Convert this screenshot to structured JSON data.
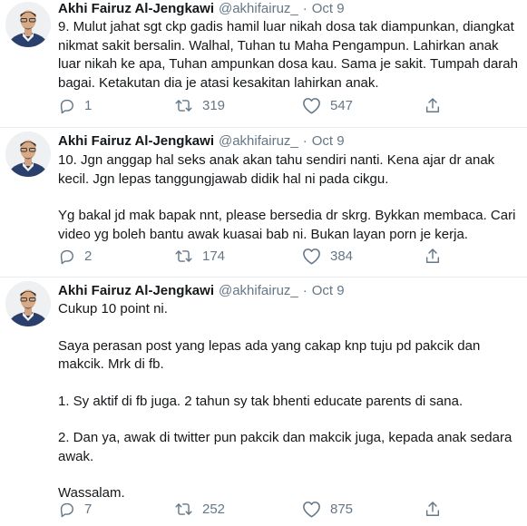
{
  "icons": {
    "reply": "reply-icon",
    "retweet": "retweet-icon",
    "like": "heart-icon",
    "share": "share-icon"
  },
  "colors": {
    "text": "#14171a",
    "secondary": "#657786",
    "divider": "#e6ecf0"
  },
  "tweets": [
    {
      "author": {
        "name": "Akhi Fairuz Al-Jengkawi",
        "handle": "@akhifairuz_"
      },
      "separator": "·",
      "date": "Oct 9",
      "paragraphs": [
        "9. Mulut jahat sgt ckp gadis hamil luar nikah dosa tak diampunkan, diangkat nikmat sakit bersalin. Walhal, Tuhan tu Maha Pengampun. Lahirkan anak luar nikah ke apa, Tuhan ampunkan dosa kau. Sama je sakit. Tumpah darah bagai. Ketakutan dia je atasi kesakitan lahirkan anak."
      ],
      "stats": {
        "replies": "1",
        "retweets": "319",
        "likes": "547"
      }
    },
    {
      "author": {
        "name": "Akhi Fairuz Al-Jengkawi",
        "handle": "@akhifairuz_"
      },
      "separator": "·",
      "date": "Oct 9",
      "paragraphs": [
        "10. Jgn anggap hal seks anak akan tahu sendiri nanti. Kena ajar dr anak kecil. Jgn lepas tanggungjawab didik hal ni pada cikgu.",
        "Yg bakal jd mak bapak nnt, please bersedia dr skrg. Bykkan membaca. Cari video yg boleh bantu awak kuasai bab ni. Bukan layan porn je kerja."
      ],
      "stats": {
        "replies": "2",
        "retweets": "174",
        "likes": "384"
      }
    },
    {
      "author": {
        "name": "Akhi Fairuz Al-Jengkawi",
        "handle": "@akhifairuz_"
      },
      "separator": "·",
      "date": "Oct 9",
      "paragraphs": [
        "Cukup 10 point ni.",
        "Saya perasan post yang lepas ada yang cakap knp tuju pd pakcik dan makcik. Mrk di fb.",
        "1. Sy aktif di fb juga. 2 tahun sy tak bhenti educate parents di sana.",
        "2. Dan ya, awak di twitter pun pakcik dan makcik juga, kepada anak sedara awak.",
        "Wassalam."
      ],
      "stats": {
        "replies": "7",
        "retweets": "252",
        "likes": "875"
      }
    }
  ]
}
